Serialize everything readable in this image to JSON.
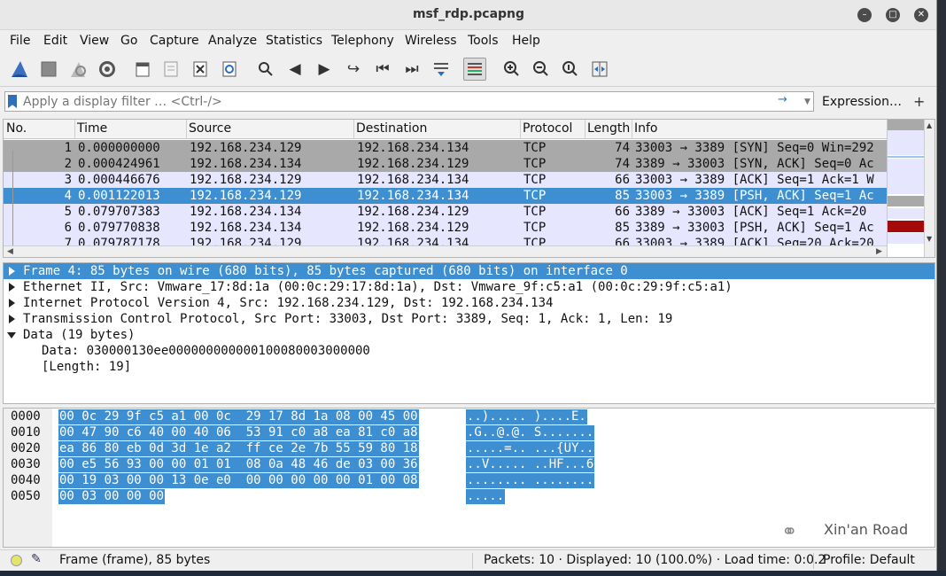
{
  "window": {
    "title": "msf_rdp.pcapng"
  },
  "menu": [
    "File",
    "Edit",
    "View",
    "Go",
    "Capture",
    "Analyze",
    "Statistics",
    "Telephony",
    "Wireless",
    "Tools",
    "Help"
  ],
  "toolbar": {
    "icons": [
      "shark-fin-start-icon",
      "stop-square-icon",
      "restart-fin-icon",
      "capture-options-gear-icon",
      "open-folder-icon",
      "file-set-icon",
      "close-file-icon",
      "reload-icon",
      "find-magnifier-icon",
      "go-back-arrow-icon",
      "go-forward-arrow-icon",
      "go-to-packet-icon",
      "first-packet-icon",
      "last-packet-icon",
      "autoscroll-icon",
      "colorize-lines-icon",
      "zoom-in-icon",
      "zoom-out-icon",
      "normal-size-icon",
      "resize-columns-icon"
    ]
  },
  "filter": {
    "placeholder": "Apply a display filter … <Ctrl-/>",
    "expression_label": "Expression…",
    "add_label": "+"
  },
  "packet_list": {
    "columns": [
      "No.",
      "Time",
      "Source",
      "Destination",
      "Protocol",
      "Length",
      "Info"
    ],
    "rows": [
      {
        "no": "1",
        "time": "0.000000000",
        "src": "192.168.234.129",
        "dst": "192.168.234.134",
        "proto": "TCP",
        "len": "74",
        "info": "33003 → 3389 [SYN] Seq=0 Win=292",
        "style": "gray"
      },
      {
        "no": "2",
        "time": "0.000424961",
        "src": "192.168.234.134",
        "dst": "192.168.234.129",
        "proto": "TCP",
        "len": "74",
        "info": "3389 → 33003 [SYN, ACK] Seq=0 Ac",
        "style": "gray"
      },
      {
        "no": "3",
        "time": "0.000446676",
        "src": "192.168.234.129",
        "dst": "192.168.234.134",
        "proto": "TCP",
        "len": "66",
        "info": "33003 → 3389 [ACK] Seq=1 Ack=1 W",
        "style": "lav"
      },
      {
        "no": "4",
        "time": "0.001122013",
        "src": "192.168.234.129",
        "dst": "192.168.234.134",
        "proto": "TCP",
        "len": "85",
        "info": "33003 → 3389 [PSH, ACK] Seq=1 Ac",
        "style": "sel"
      },
      {
        "no": "5",
        "time": "0.079707383",
        "src": "192.168.234.134",
        "dst": "192.168.234.129",
        "proto": "TCP",
        "len": "66",
        "info": "3389 → 33003 [ACK] Seq=1 Ack=20",
        "style": "lav"
      },
      {
        "no": "6",
        "time": "0.079770838",
        "src": "192.168.234.134",
        "dst": "192.168.234.129",
        "proto": "TCP",
        "len": "85",
        "info": "3389 → 33003 [PSH, ACK] Seq=1 Ac",
        "style": "lav"
      },
      {
        "no": "7",
        "time": "0.079787178",
        "src": "192.168.234.129",
        "dst": "192.168.234.134",
        "proto": "TCP",
        "len": "66",
        "info": "33003 → 3389 [ACK] Seq=20 Ack=20",
        "style": "lav"
      }
    ]
  },
  "details": [
    {
      "text": "Frame 4: 85 bytes on wire (680 bits), 85 bytes captured (680 bits) on interface 0",
      "state": "closed",
      "selected": true,
      "indent": false
    },
    {
      "text": "Ethernet II, Src: Vmware_17:8d:1a (00:0c:29:17:8d:1a), Dst: Vmware_9f:c5:a1 (00:0c:29:9f:c5:a1)",
      "state": "closed",
      "selected": false,
      "indent": false
    },
    {
      "text": "Internet Protocol Version 4, Src: 192.168.234.129, Dst: 192.168.234.134",
      "state": "closed",
      "selected": false,
      "indent": false
    },
    {
      "text": "Transmission Control Protocol, Src Port: 33003, Dst Port: 3389, Seq: 1, Ack: 1, Len: 19",
      "state": "closed",
      "selected": false,
      "indent": false
    },
    {
      "text": "Data (19 bytes)",
      "state": "open",
      "selected": false,
      "indent": false
    },
    {
      "text": "Data: 030000130ee000000000000100080003000000",
      "state": "leaf",
      "selected": false,
      "indent": true
    },
    {
      "text": "[Length: 19]",
      "state": "leaf",
      "selected": false,
      "indent": true
    }
  ],
  "bytes": [
    {
      "offset": "0000",
      "hex": "00 0c 29 9f c5 a1 00 0c  29 17 8d 1a 08 00 45 00",
      "ascii": "..)..... )....E."
    },
    {
      "offset": "0010",
      "hex": "00 47 90 c6 40 00 40 06  53 91 c0 a8 ea 81 c0 a8",
      "ascii": ".G..@.@. S......."
    },
    {
      "offset": "0020",
      "hex": "ea 86 80 eb 0d 3d 1e a2  ff ce 2e 7b 55 59 80 18",
      "ascii": ".....=.. ...{UY.."
    },
    {
      "offset": "0030",
      "hex": "00 e5 56 93 00 00 01 01  08 0a 48 46 de 03 00 36",
      "ascii": "..V..... ..HF...6"
    },
    {
      "offset": "0040",
      "hex": "00 19 03 00 00 13 0e e0  00 00 00 00 00 01 00 08",
      "ascii": "........ ........"
    },
    {
      "offset": "0050",
      "hex": "00 03 00 00 00",
      "ascii": "....."
    }
  ],
  "watermark": {
    "text": "Xin'an Road"
  },
  "status": {
    "field": "Frame (frame), 85 bytes",
    "packets": "Packets: 10 · Displayed: 10 (100.0%) · Load time: 0:0.2",
    "profile": "Profile: Default"
  }
}
